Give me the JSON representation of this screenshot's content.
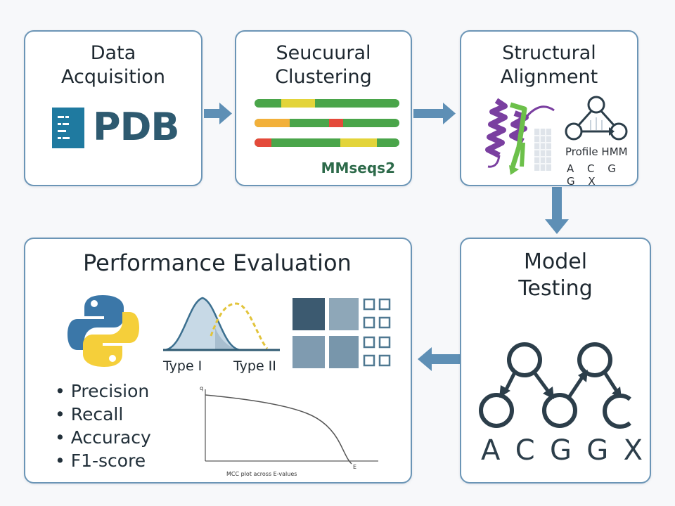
{
  "boxes": {
    "data_acquisition": {
      "title_line1": "Data",
      "title_line2": "Acquisition",
      "logo_text": "PDB"
    },
    "clustering": {
      "title_line1": "Seucuural",
      "title_line2": "Clustering",
      "tool_label": "MMseqs2"
    },
    "structural_alignment": {
      "title_line1": "Structural",
      "title_line2": "Alignment",
      "model_label": "Profile HMM",
      "sequence": "A C G G X"
    },
    "model_testing": {
      "title_line1": "Model",
      "title_line2": "Testing",
      "sequence": [
        "A",
        "C",
        "G",
        "G",
        "X"
      ]
    },
    "performance_evaluation": {
      "title": "Performance Evaluation",
      "type1_label": "Type I",
      "type2_label": "Type II",
      "metrics": [
        "Precision",
        "Recall",
        "Accuracy",
        "F1-score"
      ],
      "plot_caption": "MCC plot across E-values",
      "plot_y_label": "q",
      "plot_x_label": "E"
    }
  },
  "colors": {
    "border": "#6b95b6",
    "arrow": "#5e8fb5",
    "cluster_green": "#4aa54a",
    "cluster_yellow": "#e3d43a",
    "cluster_orange": "#f2b03a",
    "cluster_red": "#e44a3a",
    "protein_purple": "#7a3fa0",
    "protein_green": "#6cc04a",
    "hmm_node": "#2c3e4a"
  }
}
